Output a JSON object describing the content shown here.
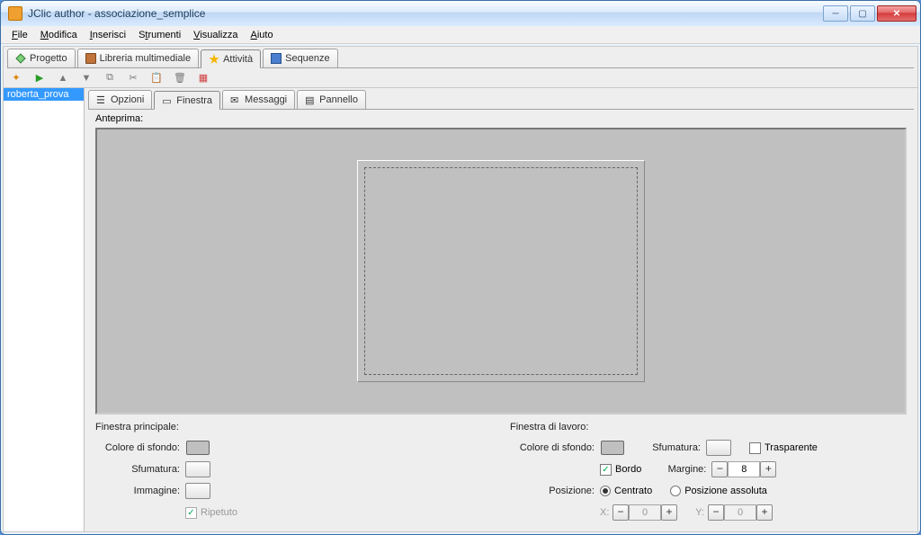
{
  "window": {
    "title": "JClic author - associazione_semplice"
  },
  "menu": {
    "file": "File",
    "edit": "Modifica",
    "insert": "Inserisci",
    "tools": "Strumenti",
    "view": "Visualizza",
    "help": "Aiuto"
  },
  "mainTabs": {
    "project": "Progetto",
    "library": "Libreria multimediale",
    "activities": "Attività",
    "sequences": "Sequenze"
  },
  "sidebar": {
    "items": [
      "roberta_prova"
    ]
  },
  "subTabs": {
    "options": "Opzioni",
    "window": "Finestra",
    "messages": "Messaggi",
    "panel": "Pannello"
  },
  "preview_label": "Anteprima:",
  "panelMain": {
    "title": "Finestra principale:",
    "bg": "Colore di sfondo:",
    "gradient": "Sfumatura:",
    "image": "Immagine:",
    "repeat": "Ripetuto"
  },
  "panelWork": {
    "title": "Finestra di lavoro:",
    "bg": "Colore di sfondo:",
    "gradient": "Sfumatura:",
    "transparent": "Trasparente",
    "border": "Bordo",
    "margin": "Margine:",
    "margin_value": "8",
    "position": "Posizione:",
    "centered": "Centrato",
    "absolute": "Posizione assoluta",
    "x_label": "X:",
    "x_value": "0",
    "y_label": "Y:",
    "y_value": "0"
  }
}
